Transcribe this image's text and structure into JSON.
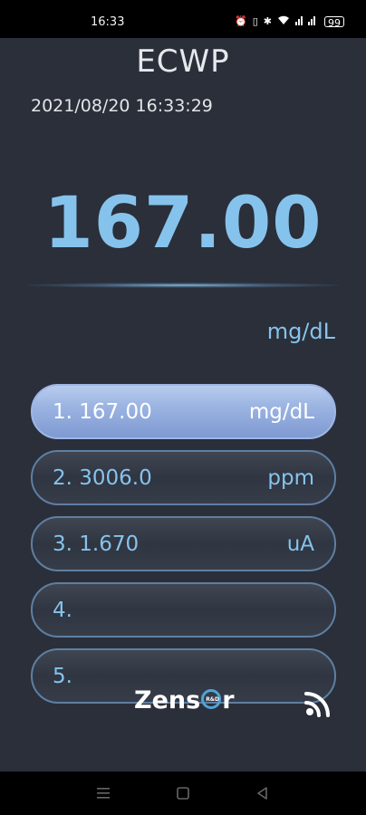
{
  "status_bar": {
    "time": "16:33",
    "battery": "99",
    "icons": [
      "alarm-icon",
      "vibrate-icon",
      "bluetooth-icon",
      "wifi-icon",
      "signal-icon",
      "battery-icon"
    ]
  },
  "app": {
    "title": "ECWP",
    "datetime": "2021/08/20 16:33:29",
    "main_reading": "167.00",
    "main_unit": "mg/dL",
    "readings": [
      {
        "label": "1. 167.00",
        "unit": "mg/dL",
        "selected": true
      },
      {
        "label": "2. 3006.0",
        "unit": "ppm",
        "selected": false
      },
      {
        "label": "3. 1.670",
        "unit": "uA",
        "selected": false
      },
      {
        "label": "4.",
        "unit": "",
        "selected": false
      },
      {
        "label": "5.",
        "unit": "",
        "selected": false
      }
    ],
    "logo_text_left": "Zens",
    "logo_text_right": "r",
    "logo_ring_text": "R&D"
  },
  "colors": {
    "background": "#2a2f3a",
    "accent": "#86c3ec",
    "selected_button": "#9bb4e2"
  }
}
